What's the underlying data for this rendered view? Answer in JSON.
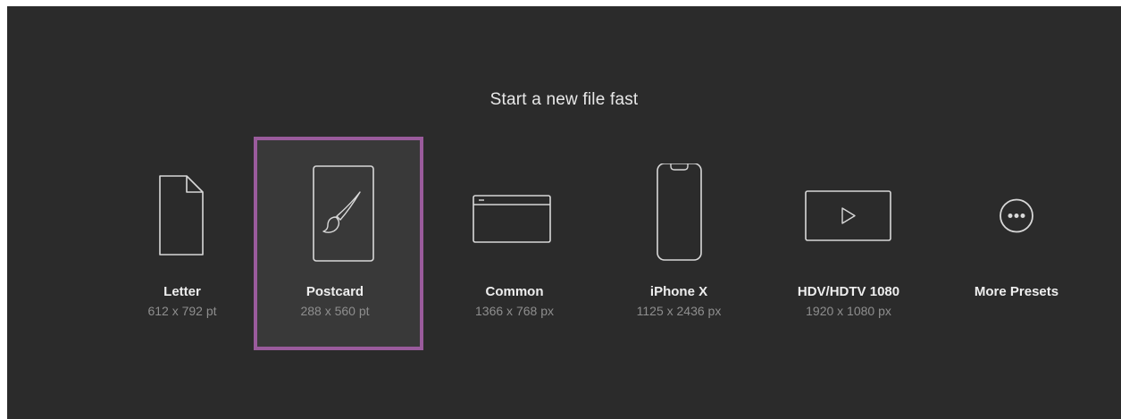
{
  "heading": "Start a new file fast",
  "presets": [
    {
      "name": "Letter",
      "dims": "612 x 792 pt",
      "icon": "document-icon",
      "selected": false
    },
    {
      "name": "Postcard",
      "dims": "288 x 560 pt",
      "icon": "paintbrush-icon",
      "selected": true
    },
    {
      "name": "Common",
      "dims": "1366 x 768 px",
      "icon": "browser-window-icon",
      "selected": false
    },
    {
      "name": "iPhone X",
      "dims": "1125 x 2436 px",
      "icon": "phone-icon",
      "selected": false
    },
    {
      "name": "HDV/HDTV 1080",
      "dims": "1920 x 1080 px",
      "icon": "video-play-icon",
      "selected": false
    },
    {
      "name": "More Presets",
      "dims": "",
      "icon": "more-icon",
      "selected": false
    }
  ],
  "colors": {
    "background": "#2b2b2b",
    "selection_border": "#9a5b9c",
    "selected_fill": "#393939",
    "icon_stroke": "#d8d8d8",
    "label": "#eeeeee",
    "sublabel": "#8e8e8e"
  }
}
